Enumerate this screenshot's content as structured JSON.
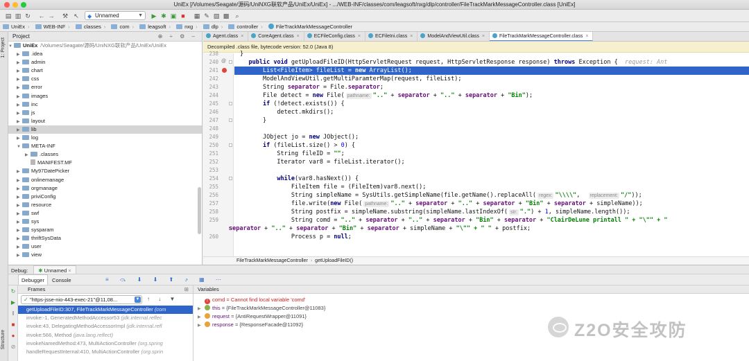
{
  "window": {
    "title": "UniEx [/Volumes/Seagate/源码/UniNXG联软产品/UniEx/UniEx] - .../WEB-INF/classes/com/leagsoft/nxg/dlp/controller/FileTrackMarkMessageController.class [UniEx]"
  },
  "toolbar": {
    "run_config": "Unnamed"
  },
  "breadcrumb": [
    "UniEx",
    "WEB-INF",
    "classes",
    "com",
    "leagsoft",
    "nxg",
    "dlp",
    "controller",
    "FileTrackMarkMessageController"
  ],
  "side_tabs": {
    "project": "1: Project",
    "structure": "Structure"
  },
  "project": {
    "title": "Project",
    "root_name": "UniEx",
    "root_path": "/Volumes/Seagate/源码/UniNXG联软产品/UniEx/UniEx",
    "items": [
      {
        "label": ".idea",
        "indent": 1,
        "arrow": "▶",
        "selected": false
      },
      {
        "label": "admin",
        "indent": 1,
        "arrow": "▶",
        "selected": false
      },
      {
        "label": "chart",
        "indent": 1,
        "arrow": "▶",
        "selected": false
      },
      {
        "label": "css",
        "indent": 1,
        "arrow": "▶",
        "selected": false
      },
      {
        "label": "error",
        "indent": 1,
        "arrow": "▶",
        "selected": false
      },
      {
        "label": "images",
        "indent": 1,
        "arrow": "▶",
        "selected": false
      },
      {
        "label": "inc",
        "indent": 1,
        "arrow": "▶",
        "selected": false
      },
      {
        "label": "js",
        "indent": 1,
        "arrow": "▶",
        "selected": false
      },
      {
        "label": "layout",
        "indent": 1,
        "arrow": "▶",
        "selected": false
      },
      {
        "label": "lib",
        "indent": 1,
        "arrow": "▶",
        "selected": true
      },
      {
        "label": "log",
        "indent": 1,
        "arrow": "▶",
        "selected": false
      },
      {
        "label": "META-INF",
        "indent": 1,
        "arrow": "▼",
        "selected": false
      },
      {
        "label": ".classes",
        "indent": 2,
        "arrow": "▶",
        "selected": false
      },
      {
        "label": "MANIFEST.MF",
        "indent": 2,
        "arrow": "",
        "selected": false
      },
      {
        "label": "My97DatePicker",
        "indent": 1,
        "arrow": "▶",
        "selected": false
      },
      {
        "label": "onlinemanage",
        "indent": 1,
        "arrow": "▶",
        "selected": false
      },
      {
        "label": "orgmanage",
        "indent": 1,
        "arrow": "▶",
        "selected": false
      },
      {
        "label": "priviConfig",
        "indent": 1,
        "arrow": "▶",
        "selected": false
      },
      {
        "label": "resource",
        "indent": 1,
        "arrow": "▶",
        "selected": false
      },
      {
        "label": "swf",
        "indent": 1,
        "arrow": "▶",
        "selected": false
      },
      {
        "label": "sys",
        "indent": 1,
        "arrow": "▶",
        "selected": false
      },
      {
        "label": "sysparam",
        "indent": 1,
        "arrow": "▶",
        "selected": false
      },
      {
        "label": "thriftSysData",
        "indent": 1,
        "arrow": "▶",
        "selected": false
      },
      {
        "label": "user",
        "indent": 1,
        "arrow": "▶",
        "selected": false
      },
      {
        "label": "view",
        "indent": 1,
        "arrow": "▶",
        "selected": false
      }
    ]
  },
  "editor": {
    "tabs": [
      {
        "label": "Agent.class",
        "active": false
      },
      {
        "label": "CoreAgent.class",
        "active": false
      },
      {
        "label": "ECFileConfig.class",
        "active": false
      },
      {
        "label": "ECFileIni.class",
        "active": false
      },
      {
        "label": "ModelAndViewUtil.class",
        "active": false
      },
      {
        "label": "FileTrackMarkMessageController.class",
        "active": true
      }
    ],
    "banner": "Decompiled .class file, bytecode version: 52.0 (Java 8)",
    "line_numbers": [
      "238",
      "240",
      "241",
      "242",
      "243",
      "244",
      "245",
      "246",
      "247",
      "248",
      "249",
      "250",
      "251",
      "252",
      "253",
      "254",
      "255",
      "256",
      "257",
      "258",
      "259",
      "",
      "260"
    ],
    "code": {
      "l238": "}",
      "l240_kw1": "public",
      "l240_kw2": "void",
      "l240_sig": " getUploadFileID(HttpServletRequest request, HttpServletResponse response) ",
      "l240_kw3": "throws",
      "l240_exc": " Exception {  ",
      "l240_hint": "request: Ant",
      "l241_a": "List<FileItem> fileList = ",
      "l241_kw": "new",
      "l241_b": " ArrayList();",
      "l242": "ModelAndViewUtil.getMultiParamterMap(request, fileList);",
      "l243_a": "String ",
      "l243_f": "separator",
      "l243_b": " = File.",
      "l243_f2": "separator",
      "l243_c": ";",
      "l244_a": "File detect = ",
      "l244_kw": "new",
      "l244_b": " File(",
      "l244_hint": "pathname:",
      "l244_s1": "\"..\"",
      "l244_c": " + ",
      "l244_f1": "separator",
      "l244_d": " + ",
      "l244_s2": "\"..\"",
      "l244_e": " + ",
      "l244_f2": "separator",
      "l244_g": " + ",
      "l244_s3": "\"Bin\"",
      "l244_h": ");",
      "l245_kw": "if",
      "l245_b": " (!detect.exists()) {",
      "l246": "detect.mkdirs();",
      "l247": "}",
      "l249_a": "JObject jo = ",
      "l249_kw": "new",
      "l249_b": " JObject();",
      "l250_kw": "if",
      "l250_b": " (fileList.size() > ",
      "l250_n": "0",
      "l250_c": ") {",
      "l251_a": "String fileID = ",
      "l251_s": "\"\"",
      "l251_b": ";",
      "l252": "Iterator var8 = fileList.iterator();",
      "l254_kw": "while",
      "l254_b": "(var8.hasNext()) {",
      "l255": "FileItem file = (FileItem)var8.next();",
      "l256_a": "String simpleName = SysUtils.getSimpleName(file.getName().replaceAll(",
      "l256_h1": "regex:",
      "l256_s1": "\"\\\\\\\\\"",
      "l256_b": ",  ",
      "l256_h2": "replacement:",
      "l256_s2": "\"/\"",
      "l256_c": "));",
      "l257_a": "file.write(",
      "l257_kw": "new",
      "l257_b": " File(",
      "l257_hint": "pathname:",
      "l257_s1": "\"..\"",
      "l257_c": " + ",
      "l257_f1": "separator",
      "l257_d": " + ",
      "l257_s2": "\"..\"",
      "l257_e": " + ",
      "l257_f2": "separator",
      "l257_g": " + ",
      "l257_s3": "\"Bin\"",
      "l257_h": " + ",
      "l257_f3": "separator",
      "l257_i": " + simpleName));",
      "l258_a": "String postfix = simpleName.substring(simpleName.lastIndexOf(",
      "l258_hint": "str:",
      "l258_s": "\".\"",
      "l258_b": ") + ",
      "l258_n": "1",
      "l258_c": ", simpleName.length());",
      "l259_a": "String comd = ",
      "l259_s1": "\"..\"",
      "l259_b": " + ",
      "l259_f1": "separator",
      "l259_c": " + ",
      "l259_s2": "\"..\"",
      "l259_d": " + ",
      "l259_f2": "separator",
      "l259_e": " + ",
      "l259_s3": "\"Bin\"",
      "l259_g": " + ",
      "l259_f3": "separator",
      "l259_h": " + ",
      "l259_s4": "\"ClairDeLune printall \" + \"\\\"\" + ",
      "l259_tail": "\"",
      "l259w_f1": "separator",
      "l259w_a": " + ",
      "l259w_s1": "\"..\"",
      "l259w_b": " + ",
      "l259w_f2": "separator",
      "l259w_c": " + ",
      "l259w_s2": "\"Bin\"",
      "l259w_d": " + ",
      "l259w_f3": "separator",
      "l259w_e": " + simpleName + ",
      "l259w_s3": "\"\\\"\" + \" \"",
      "l259w_g": " + postfix;",
      "l260_a": "Process p = ",
      "l260_kw": "null",
      "l260_b": ";"
    },
    "crumbs": [
      "FileTrackMarkMessageController",
      "getUploadFileID()"
    ]
  },
  "debug": {
    "label": "Debug:",
    "session_tab": "Unnamed",
    "tabs": [
      "Debugger",
      "Console"
    ],
    "frames_title": "Frames",
    "variables_title": "Variables",
    "thread": "\"https-jsse-nio-443-exec-21\"@11,08...",
    "frames": [
      {
        "method": "getUploadFileID:307, FileTrackMarkMessageController",
        "pkg": "(com",
        "selected": true
      },
      {
        "method": "invoke:-1, GeneratedMethodAccessor53",
        "pkg": "(jdk.internal.reflec",
        "selected": false
      },
      {
        "method": "invoke:43, DelegatingMethodAccessorImpl",
        "pkg": "(jdk.internal.refl",
        "selected": false
      },
      {
        "method": "invoke:566, Method",
        "pkg": "(java.lang.reflect)",
        "selected": false
      },
      {
        "method": "invokeNamedMethod:473, MultiActionController",
        "pkg": "(org.spring",
        "selected": false
      },
      {
        "method": "handleRequestInternal:410, MultiActionController",
        "pkg": "(org.sprin",
        "selected": false
      }
    ],
    "variables": [
      {
        "name": "comd",
        "sep": " = ",
        "value": "Cannot find local variable 'comd'",
        "error": true,
        "icon_color": "#e0443a"
      },
      {
        "name": "this",
        "sep": " = ",
        "value": "{FileTrackMarkMessageController@11083}",
        "error": false,
        "icon_color": "#8fb04a"
      },
      {
        "name": "request",
        "sep": " = ",
        "value": "{AntiRequestWrapper@11091}",
        "error": false,
        "icon_color": "#e8a33a"
      },
      {
        "name": "response",
        "sep": " = ",
        "value": "{ResponseFacade@11092}",
        "error": false,
        "icon_color": "#e8a33a"
      }
    ]
  },
  "watermark": {
    "text": "Z2O安全攻防"
  }
}
